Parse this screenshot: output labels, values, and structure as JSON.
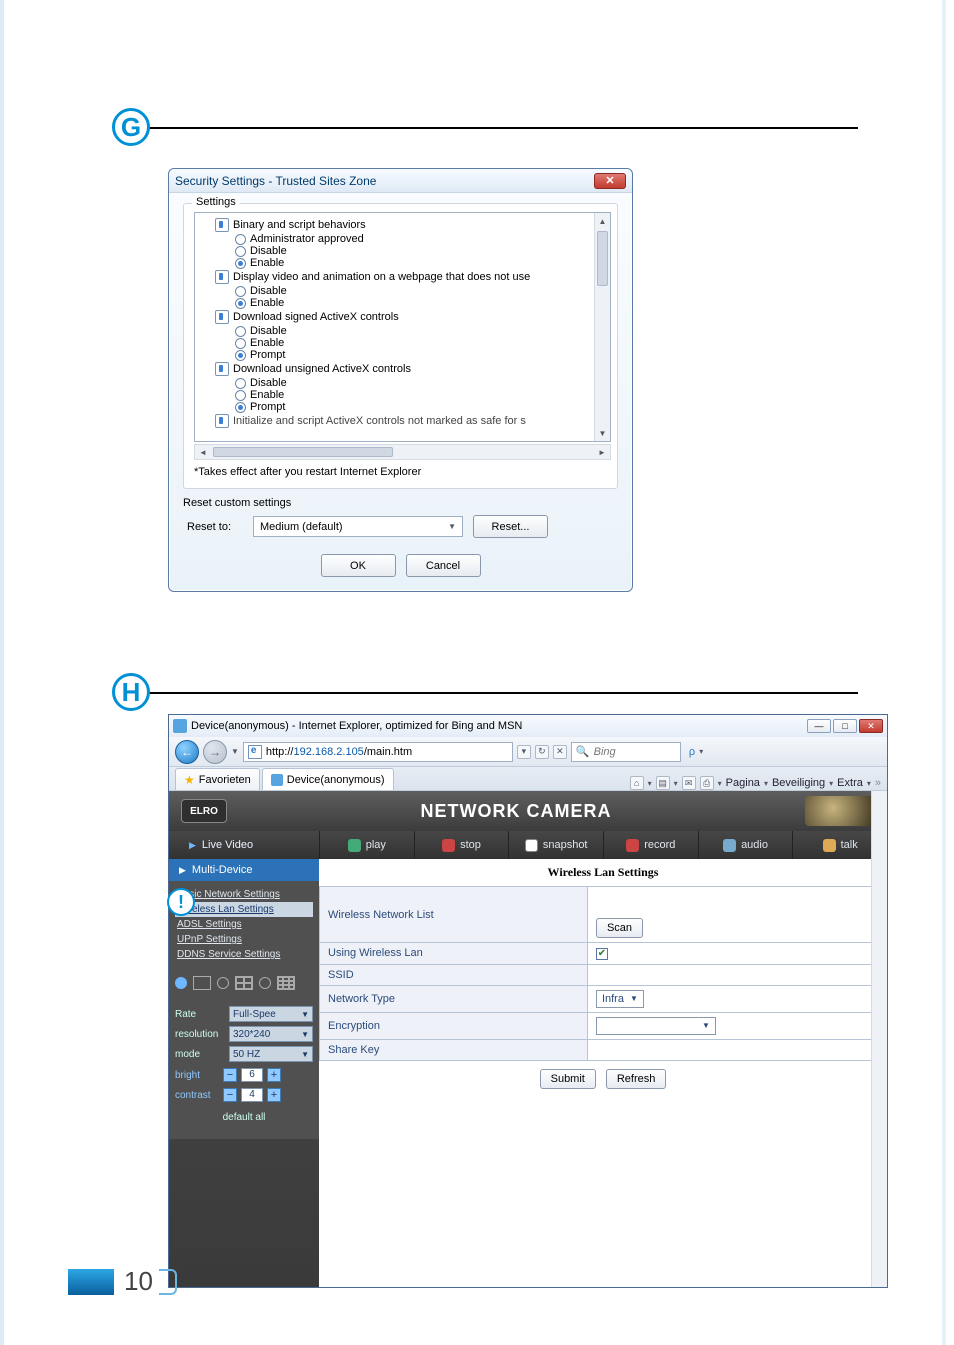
{
  "markers": {
    "g": "G",
    "h": "H",
    "bang": "!"
  },
  "sec": {
    "title": "Security Settings - Trusted Sites Zone",
    "legend": "Settings",
    "items": [
      {
        "label": "Binary and script behaviors",
        "opts": [
          "Administrator approved",
          "Disable",
          "Enable"
        ],
        "selected": 2
      },
      {
        "label": "Display video and animation on a webpage that does not use",
        "opts": [
          "Disable",
          "Enable"
        ],
        "selected": 1
      },
      {
        "label": "Download signed ActiveX controls",
        "opts": [
          "Disable",
          "Enable",
          "Prompt"
        ],
        "selected": 2
      },
      {
        "label": "Download unsigned ActiveX controls",
        "opts": [
          "Disable",
          "Enable",
          "Prompt"
        ],
        "selected": 2
      }
    ],
    "cutItem": "Initialize and script ActiveX controls not marked as safe for s",
    "note": "*Takes effect after you restart Internet Explorer",
    "reset": {
      "heading": "Reset custom settings",
      "label": "Reset to:",
      "value": "Medium (default)",
      "button": "Reset..."
    },
    "ok": "OK",
    "cancel": "Cancel"
  },
  "ie": {
    "title": "Device(anonymous) - Internet Explorer, optimized for Bing and MSN",
    "url_pre": "http://",
    "url_hl": "192.168.2.105",
    "url_post": "/main.htm",
    "search_placeholder": "Bing",
    "tabs": {
      "fav": "Favorieten",
      "active": "Device(anonymous)"
    },
    "tool_menu": [
      "Pagina",
      "Beveiliging",
      "Extra"
    ],
    "magnifier": "ρ"
  },
  "cam": {
    "logo": "ELRO",
    "banner": "NETWORK CAMERA",
    "live": "Live Video",
    "buttons": {
      "play": "play",
      "stop": "stop",
      "snapshot": "snapshot",
      "record": "record",
      "audio": "audio",
      "talk": "talk"
    },
    "side": {
      "multi": "Multi-Device",
      "menu": [
        "Basic Network Settings",
        "Wireless Lan Settings",
        "ADSL Settings",
        "UPnP Settings",
        "DDNS Service Settings"
      ],
      "selected": 1,
      "rate_label": "Rate",
      "rate_value": "Full-Spee",
      "res_label": "resolution",
      "res_value": "320*240",
      "mode_label": "mode",
      "mode_value": "50 HZ",
      "bright_label": "bright",
      "bright_value": "6",
      "contrast_label": "contrast",
      "contrast_value": "4",
      "default": "default all"
    },
    "pane": {
      "title": "Wireless Lan Settings",
      "rows": {
        "wnl": "Wireless Network List",
        "scan": "Scan",
        "uwl": "Using Wireless Lan",
        "ssid": "SSID",
        "nettype": "Network Type",
        "nettype_val": "Infra",
        "enc": "Encryption",
        "share": "Share Key"
      },
      "submit": "Submit",
      "refresh": "Refresh"
    }
  },
  "page_number": "10"
}
